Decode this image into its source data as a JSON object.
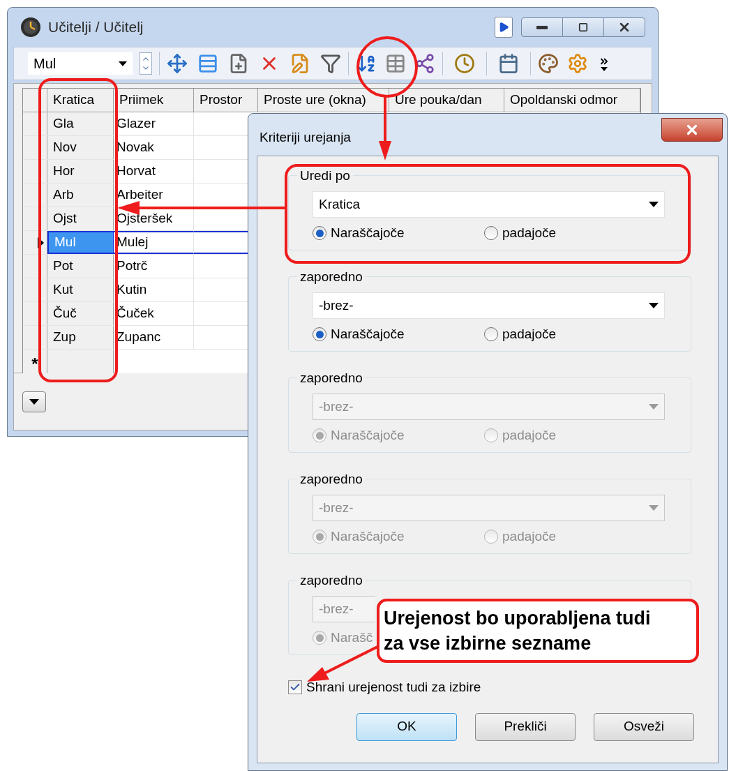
{
  "main_window": {
    "title": "Učitelji / Učitelj",
    "toolbar": {
      "combo_value": "Mul"
    },
    "table": {
      "columns": [
        "Kratica",
        "Priimek",
        "Prostor",
        "Proste ure (okna)",
        "Ure pouka/dan",
        "Opoldanski odmor"
      ],
      "rows": [
        {
          "kratica": "Gla",
          "priimek": "Glazer",
          "selected": false
        },
        {
          "kratica": "Nov",
          "priimek": "Novak",
          "selected": false
        },
        {
          "kratica": "Hor",
          "priimek": "Horvat",
          "selected": false
        },
        {
          "kratica": "Arb",
          "priimek": "Arbeiter",
          "selected": false
        },
        {
          "kratica": "Ojst",
          "priimek": "Ojsteršek",
          "selected": false
        },
        {
          "kratica": "Mul",
          "priimek": "Mulej",
          "selected": true
        },
        {
          "kratica": "Pot",
          "priimek": "Potrč",
          "selected": false
        },
        {
          "kratica": "Kut",
          "priimek": "Kutin",
          "selected": false
        },
        {
          "kratica": "Čuč",
          "priimek": "Čuček",
          "selected": false
        },
        {
          "kratica": "Zup",
          "priimek": "Zupanc",
          "selected": false
        }
      ],
      "new_row_marker": "*"
    }
  },
  "dialog": {
    "title": "Kriteriji urejanja",
    "groups": [
      {
        "legend": "Uredi po",
        "value": "Kratica",
        "disabled": false,
        "options": [
          {
            "label": "Naraščajoče",
            "selected": true
          },
          {
            "label": "padajoče",
            "selected": false
          }
        ]
      },
      {
        "legend": "zaporedno",
        "value": "-brez-",
        "disabled": false,
        "options": [
          {
            "label": "Naraščajoče",
            "selected": true
          },
          {
            "label": "padajoče",
            "selected": false
          }
        ]
      },
      {
        "legend": "zaporedno",
        "value": "-brez-",
        "disabled": true,
        "options": [
          {
            "label": "Naraščajoče",
            "selected": true
          },
          {
            "label": "padajoče",
            "selected": false
          }
        ]
      },
      {
        "legend": "zaporedno",
        "value": "-brez-",
        "disabled": true,
        "options": [
          {
            "label": "Naraščajoče",
            "selected": true
          },
          {
            "label": "padajoče",
            "selected": false
          }
        ]
      },
      {
        "legend": "zaporedno",
        "value": "-brez-",
        "disabled": true,
        "options": [
          {
            "label": "Narašč",
            "selected": true
          }
        ]
      }
    ],
    "checkbox": {
      "label": "Shrani urejenost tudi za izbire",
      "checked": true
    },
    "buttons": [
      {
        "label": "OK",
        "default": true
      },
      {
        "label": "Prekliči",
        "default": false
      },
      {
        "label": "Osveži",
        "default": false
      }
    ]
  },
  "callout": {
    "text": "Urejenost bo uporabljena tudi za vse izbirne sezname"
  }
}
